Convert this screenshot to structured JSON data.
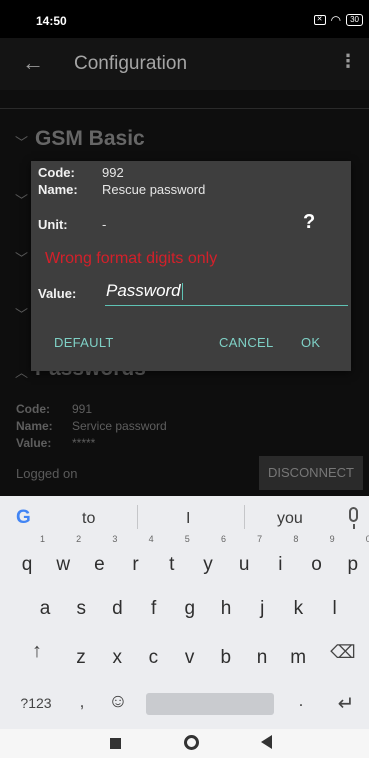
{
  "status_bar": {
    "time": "14:50",
    "battery": "30"
  },
  "app_bar": {
    "title": "Configuration"
  },
  "background": {
    "section1_title": "GSM Basic",
    "section2_title": "Passwords",
    "row_code_label": "Code:",
    "row_code_value": "991",
    "row_name_label": "Name:",
    "row_name_value": "Service password",
    "row_value_label": "Value:",
    "row_value_value": "*****",
    "status_text": "Logged on",
    "disconnect_label": "DISCONNECT"
  },
  "dialog": {
    "code_label": "Code:",
    "code_value": "992",
    "name_label": "Name:",
    "name_value": "Rescue password",
    "unit_label": "Unit:",
    "unit_value": "-",
    "help_icon": "?",
    "error_text": "Wrong format digits only",
    "value_label": "Value:",
    "value_input": "Password",
    "default_label": "DEFAULT",
    "cancel_label": "CANCEL",
    "ok_label": "OK",
    "accent_color": "#5fc3b5",
    "error_color": "#d4202a"
  },
  "keyboard": {
    "suggestions": [
      "to",
      "I",
      "you"
    ],
    "row1": [
      {
        "k": "q",
        "h": "1"
      },
      {
        "k": "w",
        "h": "2"
      },
      {
        "k": "e",
        "h": "3"
      },
      {
        "k": "r",
        "h": "4"
      },
      {
        "k": "t",
        "h": "5"
      },
      {
        "k": "y",
        "h": "6"
      },
      {
        "k": "u",
        "h": "7"
      },
      {
        "k": "i",
        "h": "8"
      },
      {
        "k": "o",
        "h": "9"
      },
      {
        "k": "p",
        "h": "0"
      }
    ],
    "row2": [
      "a",
      "s",
      "d",
      "f",
      "g",
      "h",
      "j",
      "k",
      "l"
    ],
    "row3": [
      "z",
      "x",
      "c",
      "v",
      "b",
      "n",
      "m"
    ],
    "symbols_label": "?123",
    "comma": ",",
    "period": ".",
    "shift_icon": "↑",
    "backspace_icon": "⌫",
    "emoji_icon": "☺",
    "enter_icon": "↵"
  }
}
